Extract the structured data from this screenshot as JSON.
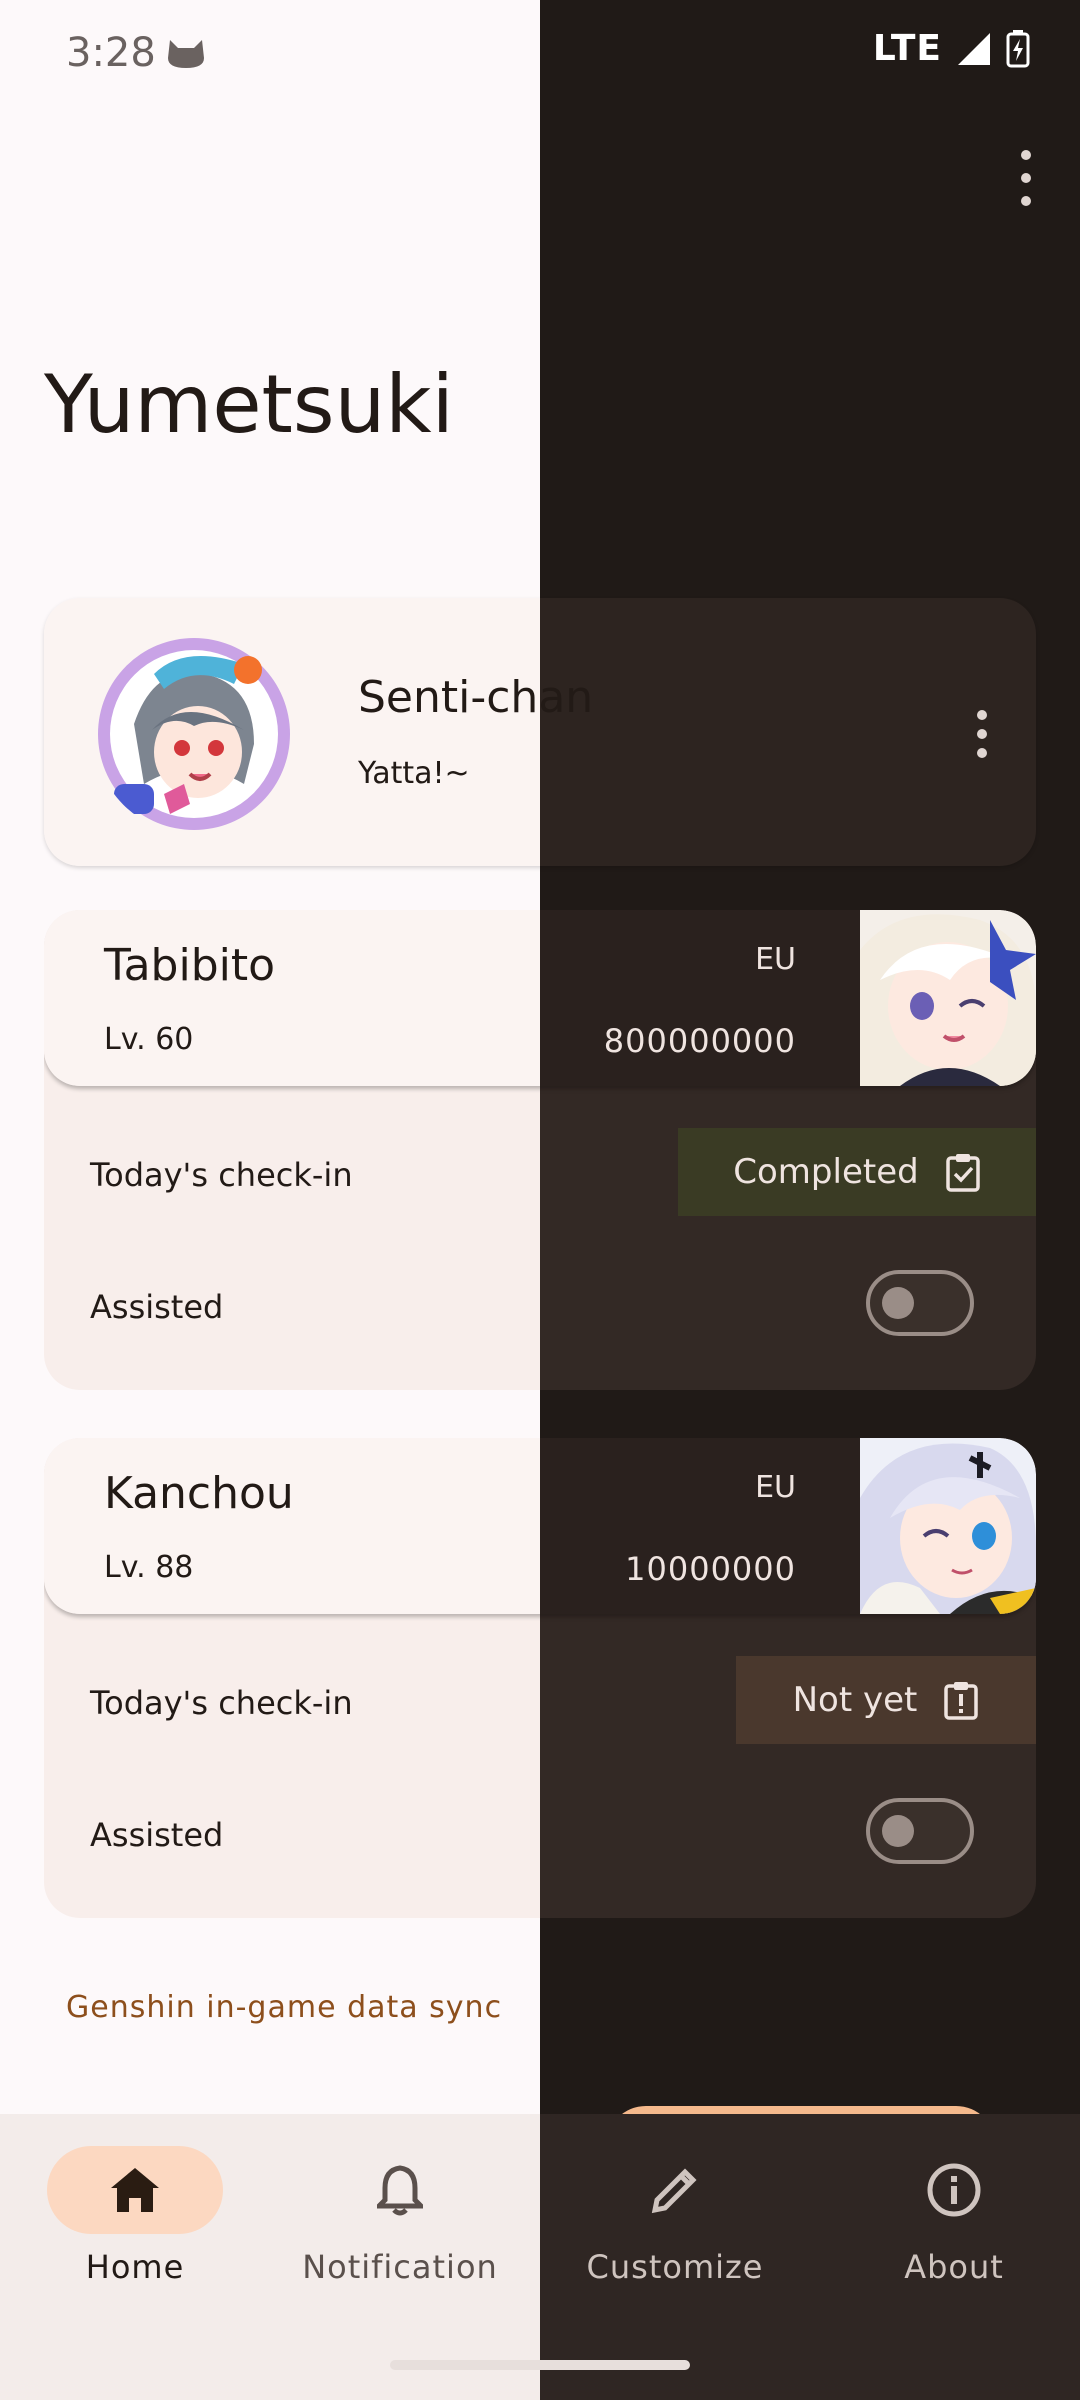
{
  "status_bar": {
    "time": "3:28",
    "network": "LTE"
  },
  "app": {
    "title": "Yumetsuki"
  },
  "profile": {
    "name": "Senti-chan",
    "status": "Yatta!~"
  },
  "accounts": [
    {
      "name": "Tabibito",
      "level": "Lv. 60",
      "region": "EU",
      "uid": "800000000",
      "checkin_label": "Today's check-in",
      "checkin_status": "Completed",
      "assisted_label": "Assisted",
      "assisted_on": false
    },
    {
      "name": "Kanchou",
      "level": "Lv. 88",
      "region": "EU",
      "uid": "10000000",
      "checkin_label": "Today's check-in",
      "checkin_status": "Not yet",
      "assisted_label": "Assisted",
      "assisted_on": false
    }
  ],
  "sync_link": "Genshin in-game data sync",
  "nav": [
    {
      "label": "Home",
      "icon": "home-icon",
      "active": true
    },
    {
      "label": "Notification",
      "icon": "bell-icon",
      "active": false
    },
    {
      "label": "Customize",
      "icon": "pencil-icon",
      "active": false
    },
    {
      "label": "About",
      "icon": "info-icon",
      "active": false
    }
  ],
  "colors": {
    "accent": "#fcd8c1",
    "link": "#8d4f1c",
    "completed_chip": "#3a3b24",
    "not_yet_chip": "#4a382d"
  }
}
